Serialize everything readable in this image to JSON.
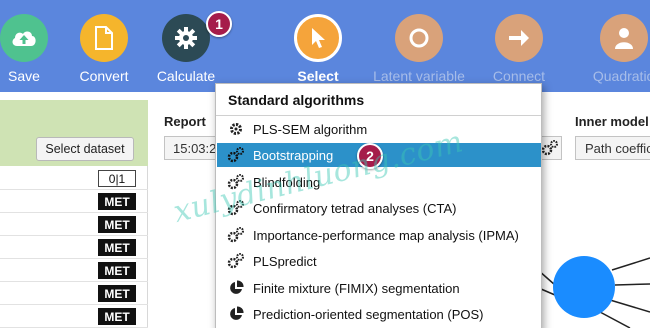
{
  "toolbar": {
    "items": [
      {
        "label": "Save",
        "icon": "cloud-upload-icon",
        "color": "#4fc28f"
      },
      {
        "label": "Convert",
        "icon": "document-icon",
        "color": "#f5b52c"
      },
      {
        "label": "Calculate",
        "icon": "gear-icon",
        "color": "#2c4a55"
      },
      {
        "label": "Select",
        "icon": "cursor-icon",
        "color": "#f5a43b"
      },
      {
        "label": "Latent variable",
        "icon": "circle-icon",
        "color": "#d9a27a"
      },
      {
        "label": "Connect",
        "icon": "arrow-right-icon",
        "color": "#d9a27a"
      },
      {
        "label": "Quadratic ef",
        "icon": "person-icon",
        "color": "#d9a27a"
      }
    ],
    "badge_calculate": "1"
  },
  "left_panel": {
    "select_dataset_label": "Select dataset",
    "rows": [
      "0|1",
      "MET",
      "MET",
      "MET",
      "MET",
      "MET",
      "MET"
    ]
  },
  "report": {
    "label": "Report",
    "value": "15:03:2"
  },
  "inner_model": {
    "label": "Inner model",
    "value": "Path coeffic"
  },
  "dropdown": {
    "header": "Standard algorithms",
    "items": [
      {
        "label": "PLS-SEM algorithm",
        "icon": "gear-icon"
      },
      {
        "label": "Bootstrapping",
        "icon": "gears-icon",
        "active": true
      },
      {
        "label": "Blindfolding",
        "icon": "gears-icon"
      },
      {
        "label": "Confirmatory tetrad analyses (CTA)",
        "icon": "gears-icon"
      },
      {
        "label": "Importance-performance map analysis (IPMA)",
        "icon": "gears-icon"
      },
      {
        "label": "PLSpredict",
        "icon": "gears-icon"
      },
      {
        "label": "Finite mixture (FIMIX) segmentation",
        "icon": "pie-icon"
      },
      {
        "label": "Prediction-oriented segmentation (POS)",
        "icon": "pie-icon"
      }
    ],
    "badge_bootstrapping": "2"
  },
  "watermark": "xulydinhluong.com",
  "colors": {
    "toolbar_bg": "#5b86dd",
    "active_item": "#2c91c9",
    "badge": "#a51c4a",
    "latent_node": "#1a8cff"
  }
}
